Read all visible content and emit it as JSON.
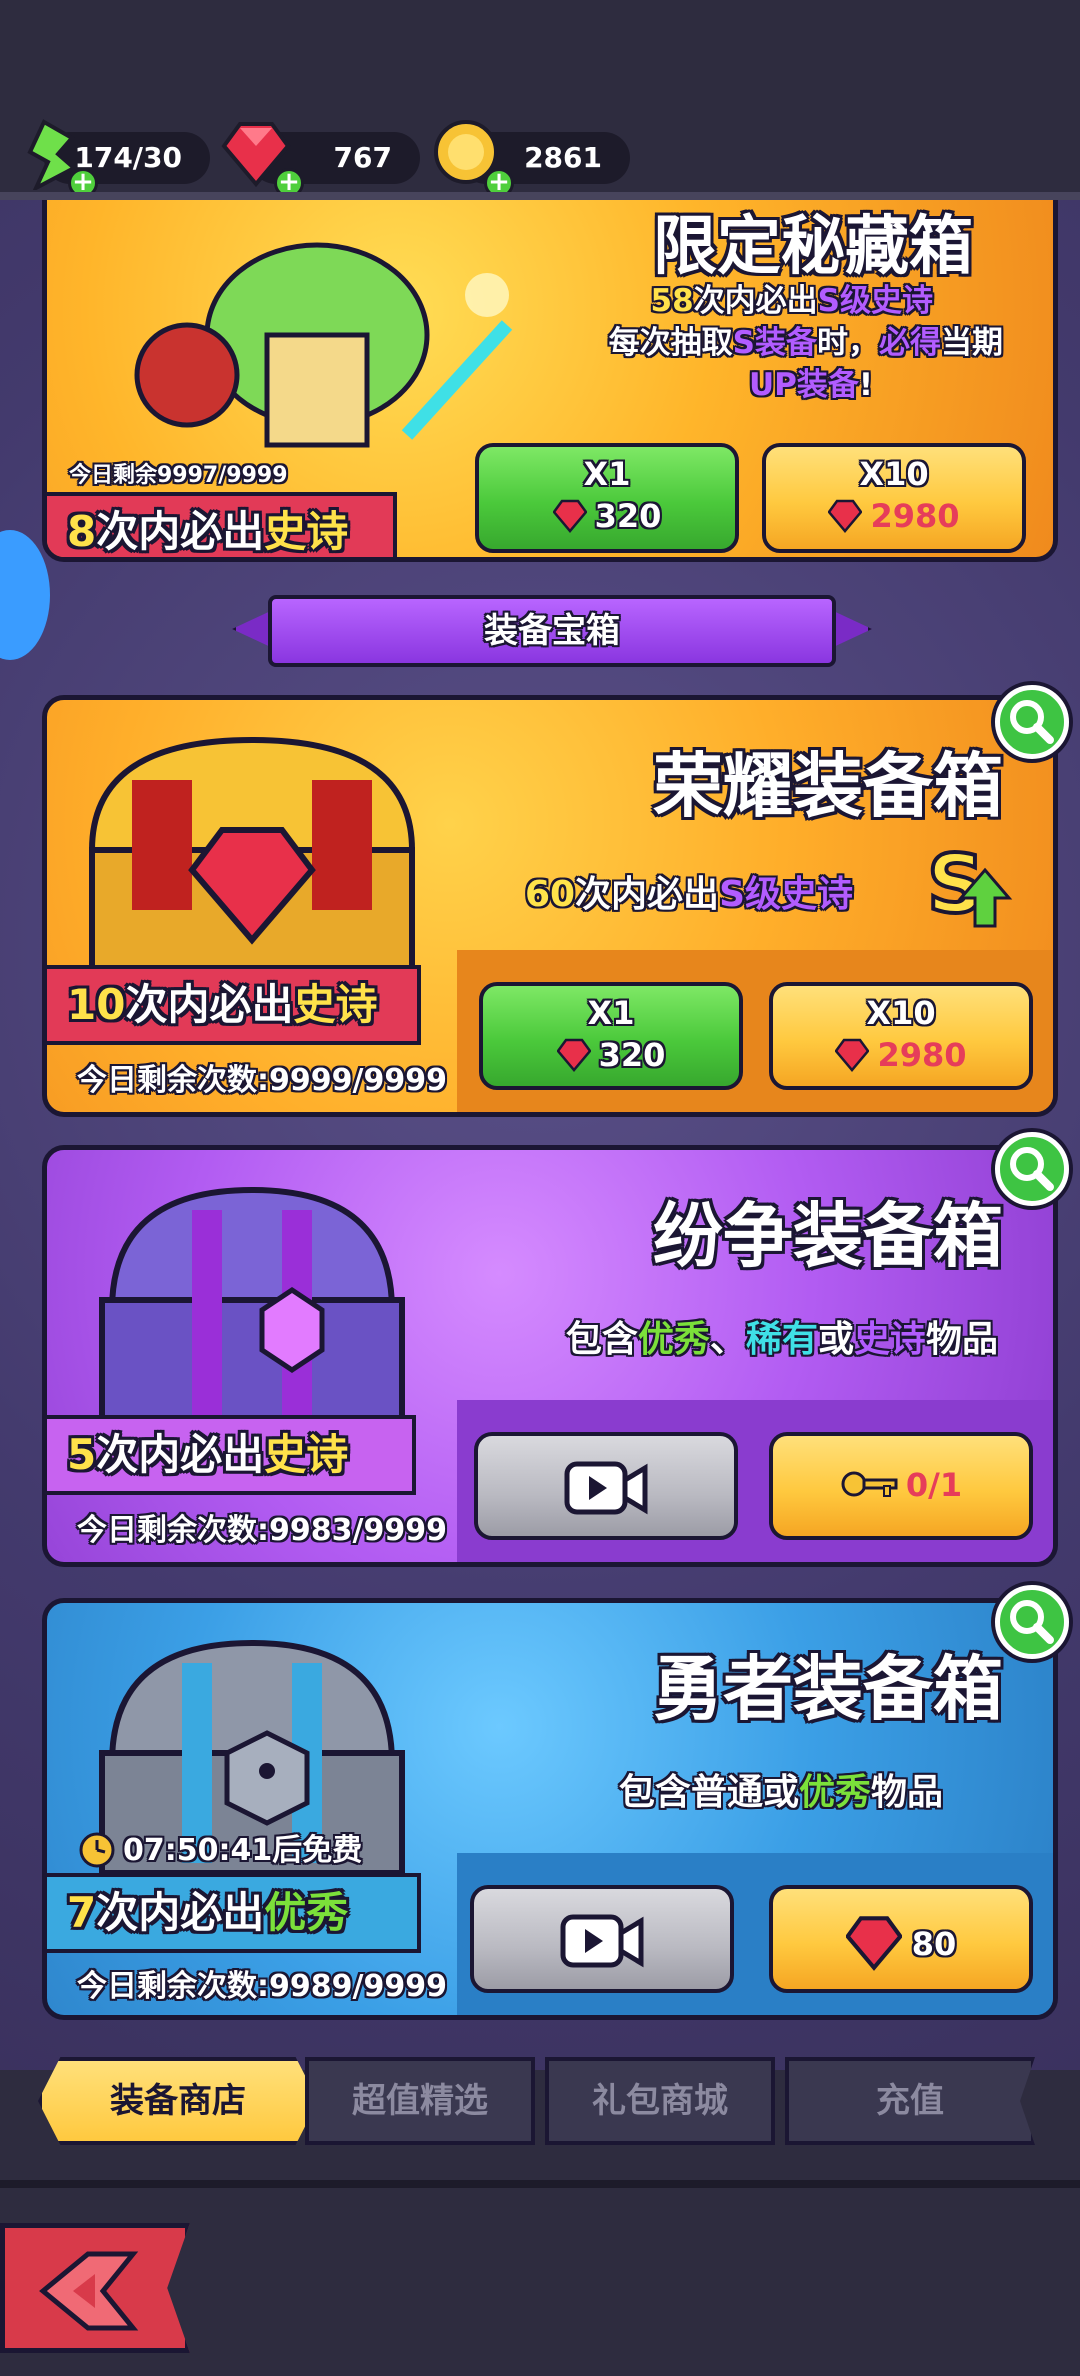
{
  "resources": [
    {
      "name": "energy",
      "value": "174/30",
      "color": "#5fd13f"
    },
    {
      "name": "ruby",
      "value": "767",
      "color": "#e8304a"
    },
    {
      "name": "gold",
      "value": "2861",
      "color": "#f7c335"
    }
  ],
  "limited_chest": {
    "title": "限定秘藏箱",
    "line1_num": "58",
    "line1_mid": "次内必出",
    "line1_hl": "S级史诗",
    "line2_a": "每次抽取",
    "line2_hl1": "S装备",
    "line2_b": "时，",
    "line2_hl2": "必得",
    "line2_c": "当期",
    "line3_hl": "UP装备",
    "line3_end": "!",
    "remain": "今日剩余9997/9999",
    "ribbon_num": "8",
    "ribbon_mid": "次内必出",
    "ribbon_hl": "史诗",
    "btn1_top": "X1",
    "btn1_price": "320",
    "btn2_top": "X10",
    "btn2_price": "2980"
  },
  "section_title": "装备宝箱",
  "glory_chest": {
    "title": "荣耀装备箱",
    "desc_num": "60",
    "desc_mid": "次内必出",
    "desc_hl": "S级史诗",
    "ribbon_num": "10",
    "ribbon_mid": "次内必出",
    "ribbon_hl": "史诗",
    "remain": "今日剩余次数:9999/9999",
    "btn1_top": "X1",
    "btn1_price": "320",
    "btn2_top": "X10",
    "btn2_price": "2980"
  },
  "strife_chest": {
    "title": "纷争装备箱",
    "desc_a": "包含",
    "desc_hl1": "优秀",
    "desc_sep": "、",
    "desc_hl2": "稀有",
    "desc_b": "或",
    "desc_hl3": "史诗",
    "desc_c": "物品",
    "ribbon_num": "5",
    "ribbon_mid": "次内必出",
    "ribbon_hl": "史诗",
    "remain": "今日剩余次数:9983/9999",
    "key_count": "0/1"
  },
  "brave_chest": {
    "title": "勇者装备箱",
    "desc_a": "包含",
    "desc_hl1": "普通",
    "desc_b": "或",
    "desc_hl2": "优秀",
    "desc_c": "物品",
    "timer": "07:50:41后免费",
    "ribbon_num": "7",
    "ribbon_mid": "次内必出",
    "ribbon_hl": "优秀",
    "remain": "今日剩余次数:9989/9999",
    "price": "80"
  },
  "tabs": [
    {
      "label": "装备商店",
      "active": true
    },
    {
      "label": "超值精选",
      "active": false
    },
    {
      "label": "礼包商城",
      "active": false
    },
    {
      "label": "充值",
      "active": false
    }
  ],
  "colors": {
    "gold_text": "#ffe24a",
    "purple_text": "#b25cff",
    "green_text": "#7be03a",
    "cyan_text": "#3fe0e6",
    "red_text": "#e63d5a"
  }
}
